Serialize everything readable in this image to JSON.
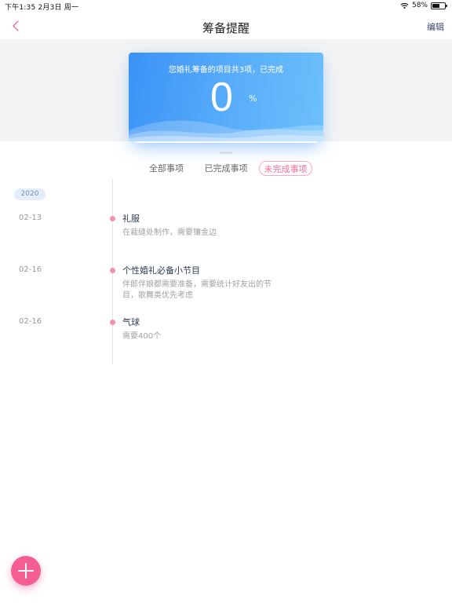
{
  "status_bar": {
    "time_date": "下午1:35   2月3日 周一",
    "battery_text": "58%",
    "battery_level": 0.58
  },
  "nav": {
    "title": "筹备提醒",
    "edit_label": "编辑",
    "back_icon": "chevron-left-icon"
  },
  "summary": {
    "description": "您婚礼筹备的项目共3项，已完成",
    "percent_value": "0",
    "percent_unit": "%"
  },
  "tabs": [
    {
      "label": "全部事项",
      "active": false
    },
    {
      "label": "已完成事项",
      "active": false
    },
    {
      "label": "未完成事项",
      "active": true
    }
  ],
  "timeline": {
    "year": "2020",
    "events": [
      {
        "date": "02-13",
        "title": "礼服",
        "note": "在裁缝处制作，需要镶金边"
      },
      {
        "date": "02-16",
        "title": "个性婚礼必备小节目",
        "note": "伴郎伴娘都需要准备，需要统计好友出的节目，歌舞类优先考虑"
      },
      {
        "date": "02-16",
        "title": "气球",
        "note": "需要400个"
      }
    ]
  },
  "fab": {
    "icon": "plus-icon"
  },
  "colors": {
    "accent_pink": "#f45e93",
    "card_blue": "#4a9ff8",
    "dot_pink": "#f48fb3"
  }
}
